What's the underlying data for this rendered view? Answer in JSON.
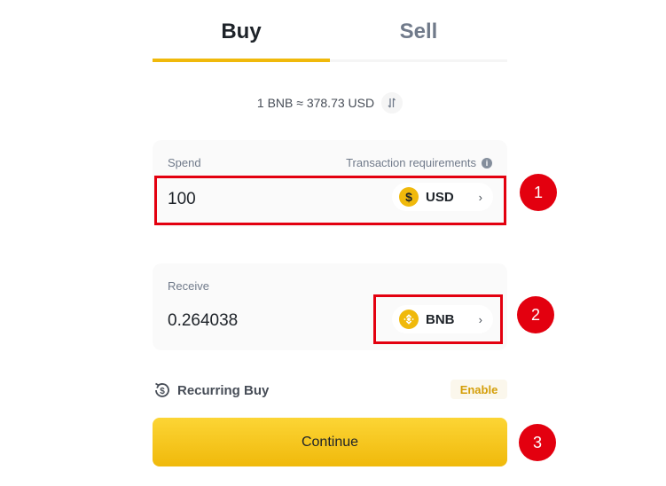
{
  "tabs": {
    "buy_label": "Buy",
    "sell_label": "Sell",
    "active": "Buy"
  },
  "rate": {
    "text": "1 BNB ≈ 378.73 USD"
  },
  "spend": {
    "label": "Spend",
    "requirements_label": "Transaction requirements",
    "amount": "100",
    "currency": "USD",
    "currency_icon": "dollar-coin-icon"
  },
  "receive": {
    "label": "Receive",
    "amount": "0.264038",
    "currency": "BNB",
    "currency_icon": "bnb-coin-icon"
  },
  "recurring": {
    "label": "Recurring Buy",
    "enable_label": "Enable"
  },
  "continue_label": "Continue",
  "markers": [
    "1",
    "2",
    "3"
  ],
  "colors": {
    "brand_yellow": "#f0b90b",
    "highlight_red": "#e3000f",
    "text_primary": "#1e2329",
    "text_secondary": "#707a8a"
  }
}
